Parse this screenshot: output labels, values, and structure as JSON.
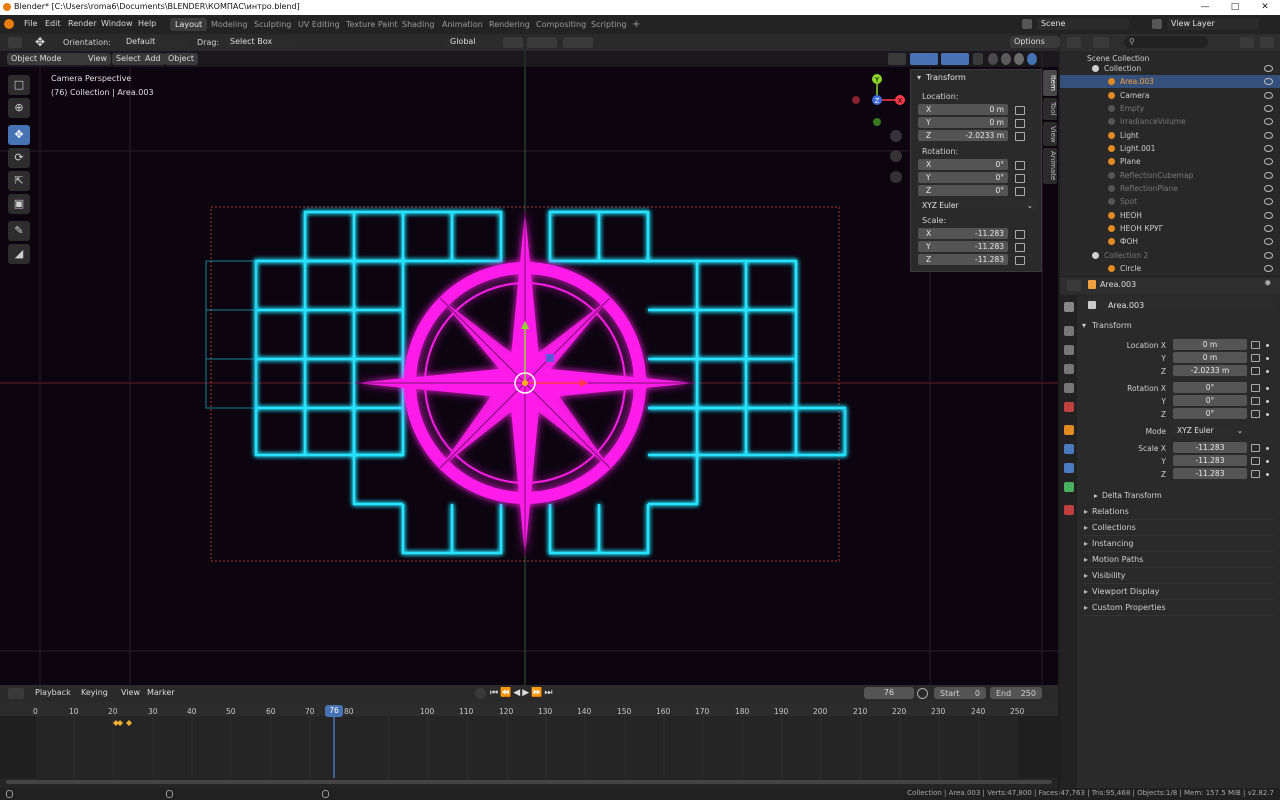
{
  "window": {
    "title": "Blender* [C:\\Users\\roma6\\Documents\\BLENDER\\КОМПАС\\интро.blend]"
  },
  "menu": [
    "File",
    "Edit",
    "Render",
    "Window",
    "Help"
  ],
  "workspaces": [
    "Layout",
    "Modeling",
    "Sculpting",
    "UV Editing",
    "Texture Paint",
    "Shading",
    "Animation",
    "Rendering",
    "Compositing",
    "Scripting"
  ],
  "workspace_active": "Layout",
  "scene": "Scene",
  "view_layer": "View Layer",
  "tool_header": {
    "orientation_label": "Orientation:",
    "orientation_value": "Default",
    "drag_label": "Drag:",
    "drag_value": "Select Box",
    "transform_orientation": "Global",
    "options": "Options"
  },
  "viewport_header": {
    "mode": "Object Mode",
    "items": [
      "View",
      "Select",
      "Add",
      "Object"
    ]
  },
  "viewport_overlay": {
    "line1": "Camera Perspective",
    "line2": "(76) Collection | Area.003"
  },
  "gizmo": {
    "x": "X",
    "y": "Y",
    "z": "Z"
  },
  "npanel": {
    "title": "Transform",
    "location_label": "Location:",
    "location": [
      {
        "axis": "X",
        "value": "0 m"
      },
      {
        "axis": "Y",
        "value": "0 m"
      },
      {
        "axis": "Z",
        "value": "-2.0233 m"
      }
    ],
    "rotation_label": "Rotation:",
    "rotation": [
      {
        "axis": "X",
        "value": "0°"
      },
      {
        "axis": "Y",
        "value": "0°"
      },
      {
        "axis": "Z",
        "value": "0°"
      }
    ],
    "rotation_mode": "XYZ Euler",
    "scale_label": "Scale:",
    "scale": [
      {
        "axis": "X",
        "value": "-11.283"
      },
      {
        "axis": "Y",
        "value": "-11.283"
      },
      {
        "axis": "Z",
        "value": "-11.283"
      }
    ],
    "tabs": [
      "Item",
      "Tool",
      "View",
      "Animate"
    ]
  },
  "outliner": {
    "root": "Scene Collection",
    "rows": [
      {
        "name": "Collection",
        "color": "#cfcfcf"
      },
      {
        "name": "Area.003",
        "color": "#f0a040",
        "selected": true
      },
      {
        "name": "Camera",
        "color": "#cfcfcf"
      },
      {
        "name": "Empty",
        "color": "#777777"
      },
      {
        "name": "IrradianceVolume",
        "color": "#777777"
      },
      {
        "name": "Light",
        "color": "#cfcfcf"
      },
      {
        "name": "Light.001",
        "color": "#cfcfcf"
      },
      {
        "name": "Plane",
        "color": "#cfcfcf"
      },
      {
        "name": "ReflectionCubemap",
        "color": "#777777"
      },
      {
        "name": "ReflectionPlane",
        "color": "#777777"
      },
      {
        "name": "Spot",
        "color": "#777777"
      },
      {
        "name": "НЕОН",
        "color": "#cfcfcf"
      },
      {
        "name": "НЕОН КРУГ",
        "color": "#cfcfcf"
      },
      {
        "name": "ФОН",
        "color": "#cfcfcf"
      },
      {
        "name": "Collection 2",
        "color": "#777777"
      },
      {
        "name": "Circle",
        "color": "#cfcfcf"
      }
    ]
  },
  "properties": {
    "object_name": "Area.003",
    "section": "Transform",
    "location": [
      {
        "label": "Location X",
        "value": "0 m"
      },
      {
        "label": "Y",
        "value": "0 m"
      },
      {
        "label": "Z",
        "value": "-2.0233 m"
      }
    ],
    "rotation": [
      {
        "label": "Rotation X",
        "value": "0°"
      },
      {
        "label": "Y",
        "value": "0°"
      },
      {
        "label": "Z",
        "value": "0°"
      }
    ],
    "mode_label": "Mode",
    "mode_value": "XYZ Euler",
    "scale": [
      {
        "label": "Scale X",
        "value": "-11.283"
      },
      {
        "label": "Y",
        "value": "-11.283"
      },
      {
        "label": "Z",
        "value": "-11.283"
      }
    ],
    "delta": "Delta Transform",
    "panels": [
      "Relations",
      "Collections",
      "Instancing",
      "Motion Paths",
      "Visibility",
      "Viewport Display",
      "Custom Properties"
    ]
  },
  "timeline": {
    "menus": [
      "Playback",
      "Keying",
      "View",
      "Marker"
    ],
    "current_frame": "76",
    "start_label": "Start",
    "start": "0",
    "end_label": "End",
    "end": "250",
    "ticks": [
      "0",
      "10",
      "20",
      "30",
      "40",
      "50",
      "60",
      "70",
      "80",
      "100",
      "110",
      "120",
      "130",
      "140",
      "150",
      "160",
      "170",
      "180",
      "190",
      "200",
      "210",
      "220",
      "230",
      "240",
      "250"
    ]
  },
  "status": "Collection | Area.003 | Verts:47,800 | Faces:47,763 | Tris:95,468 | Objects:1/8 | Mem: 157.5 MiB | v2.82.7",
  "colors": {
    "neon_cyan": "#27e3ff",
    "neon_magenta": "#ff1eea",
    "selection": "#4772b3",
    "accent": "#e87d0d"
  }
}
